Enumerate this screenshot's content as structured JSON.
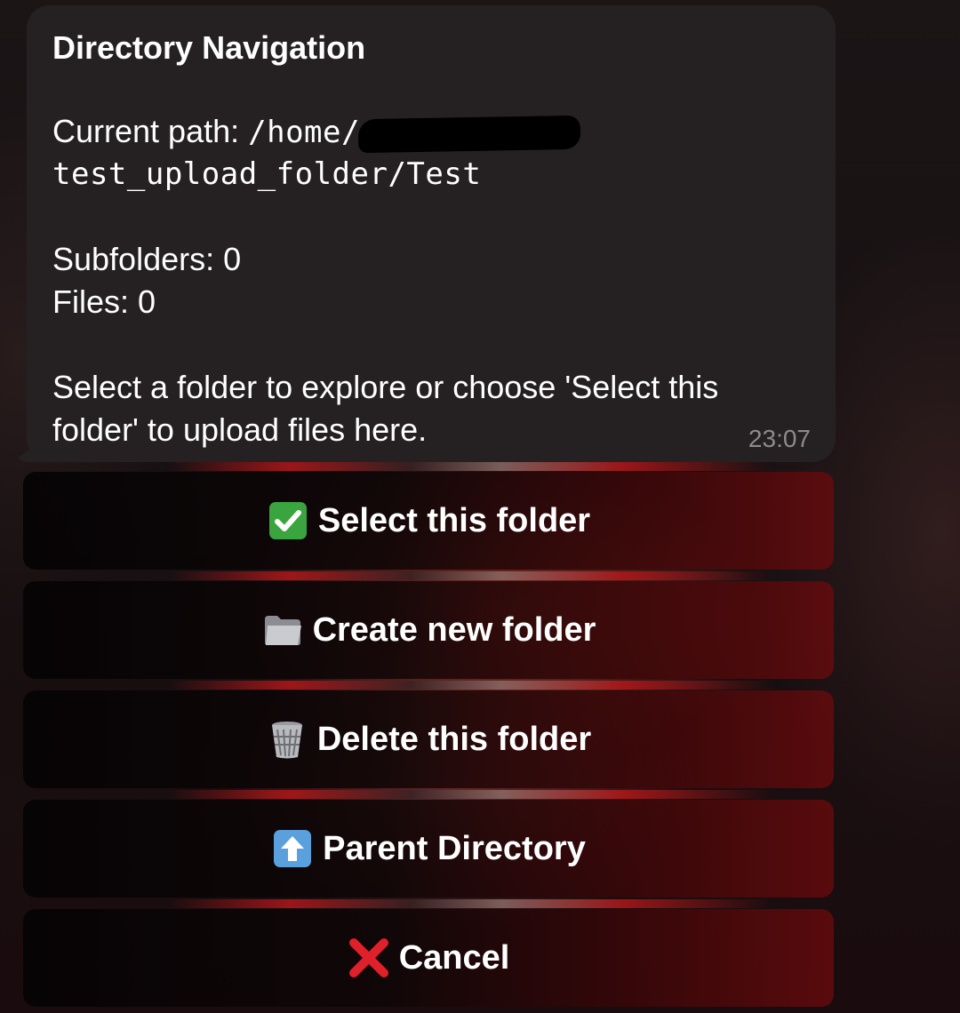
{
  "message": {
    "title": "Directory Navigation",
    "path_label": "Current path:",
    "path_start": "/home/",
    "path_end": "test_upload_folder/Test",
    "subfolders_line": "Subfolders: 0",
    "files_line": "Files: 0",
    "instructions_line1": "Select a folder to explore or choose 'Select this",
    "instructions_line2": "folder' to upload files here.",
    "time": "23:07"
  },
  "buttons": [
    {
      "icon": "check-mark-button-icon",
      "label": "Select this folder"
    },
    {
      "icon": "folder-icon",
      "label": "Create new folder"
    },
    {
      "icon": "wastebasket-icon",
      "label": "Delete this folder"
    },
    {
      "icon": "up-arrow-icon",
      "label": "Parent Directory"
    },
    {
      "icon": "cross-mark-icon",
      "label": "Cancel"
    }
  ],
  "colors": {
    "bubble": "#252122",
    "check_green": "#3aa53e",
    "cross_red": "#e0202a",
    "up_arrow_blue": "#5aa0dc",
    "timestamp": "#8d8a8b"
  }
}
